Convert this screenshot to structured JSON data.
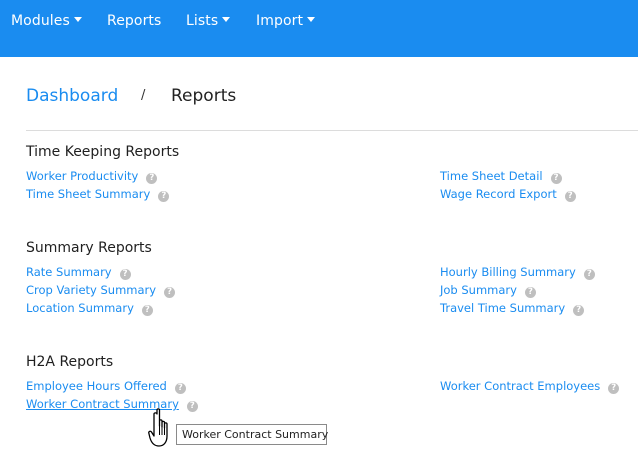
{
  "nav": {
    "modules": "Modules",
    "reports": "Reports",
    "lists": "Lists",
    "import": "Import"
  },
  "breadcrumb": {
    "home": "Dashboard",
    "separator": "/",
    "current": "Reports"
  },
  "sections": {
    "timekeeping": {
      "title": "Time Keeping Reports",
      "left": [
        "Worker Productivity",
        "Time Sheet Summary"
      ],
      "right": [
        "Time Sheet Detail",
        "Wage Record Export"
      ]
    },
    "summary": {
      "title": "Summary Reports",
      "left": [
        "Rate Summary",
        "Crop Variety Summary",
        "Location Summary"
      ],
      "right": [
        "Hourly Billing Summary",
        "Job Summary",
        "Travel Time Summary"
      ]
    },
    "h2a": {
      "title": "H2A Reports",
      "left": [
        "Employee Hours Offered",
        "Worker Contract Summary"
      ],
      "right": [
        "Worker Contract Employees"
      ]
    }
  },
  "help_glyph": "?",
  "tooltip": "Worker Contract Summary",
  "colors": {
    "nav_bg": "#1a8cf0",
    "link": "#1a8cf0",
    "help_icon": "#bfbfbf"
  }
}
